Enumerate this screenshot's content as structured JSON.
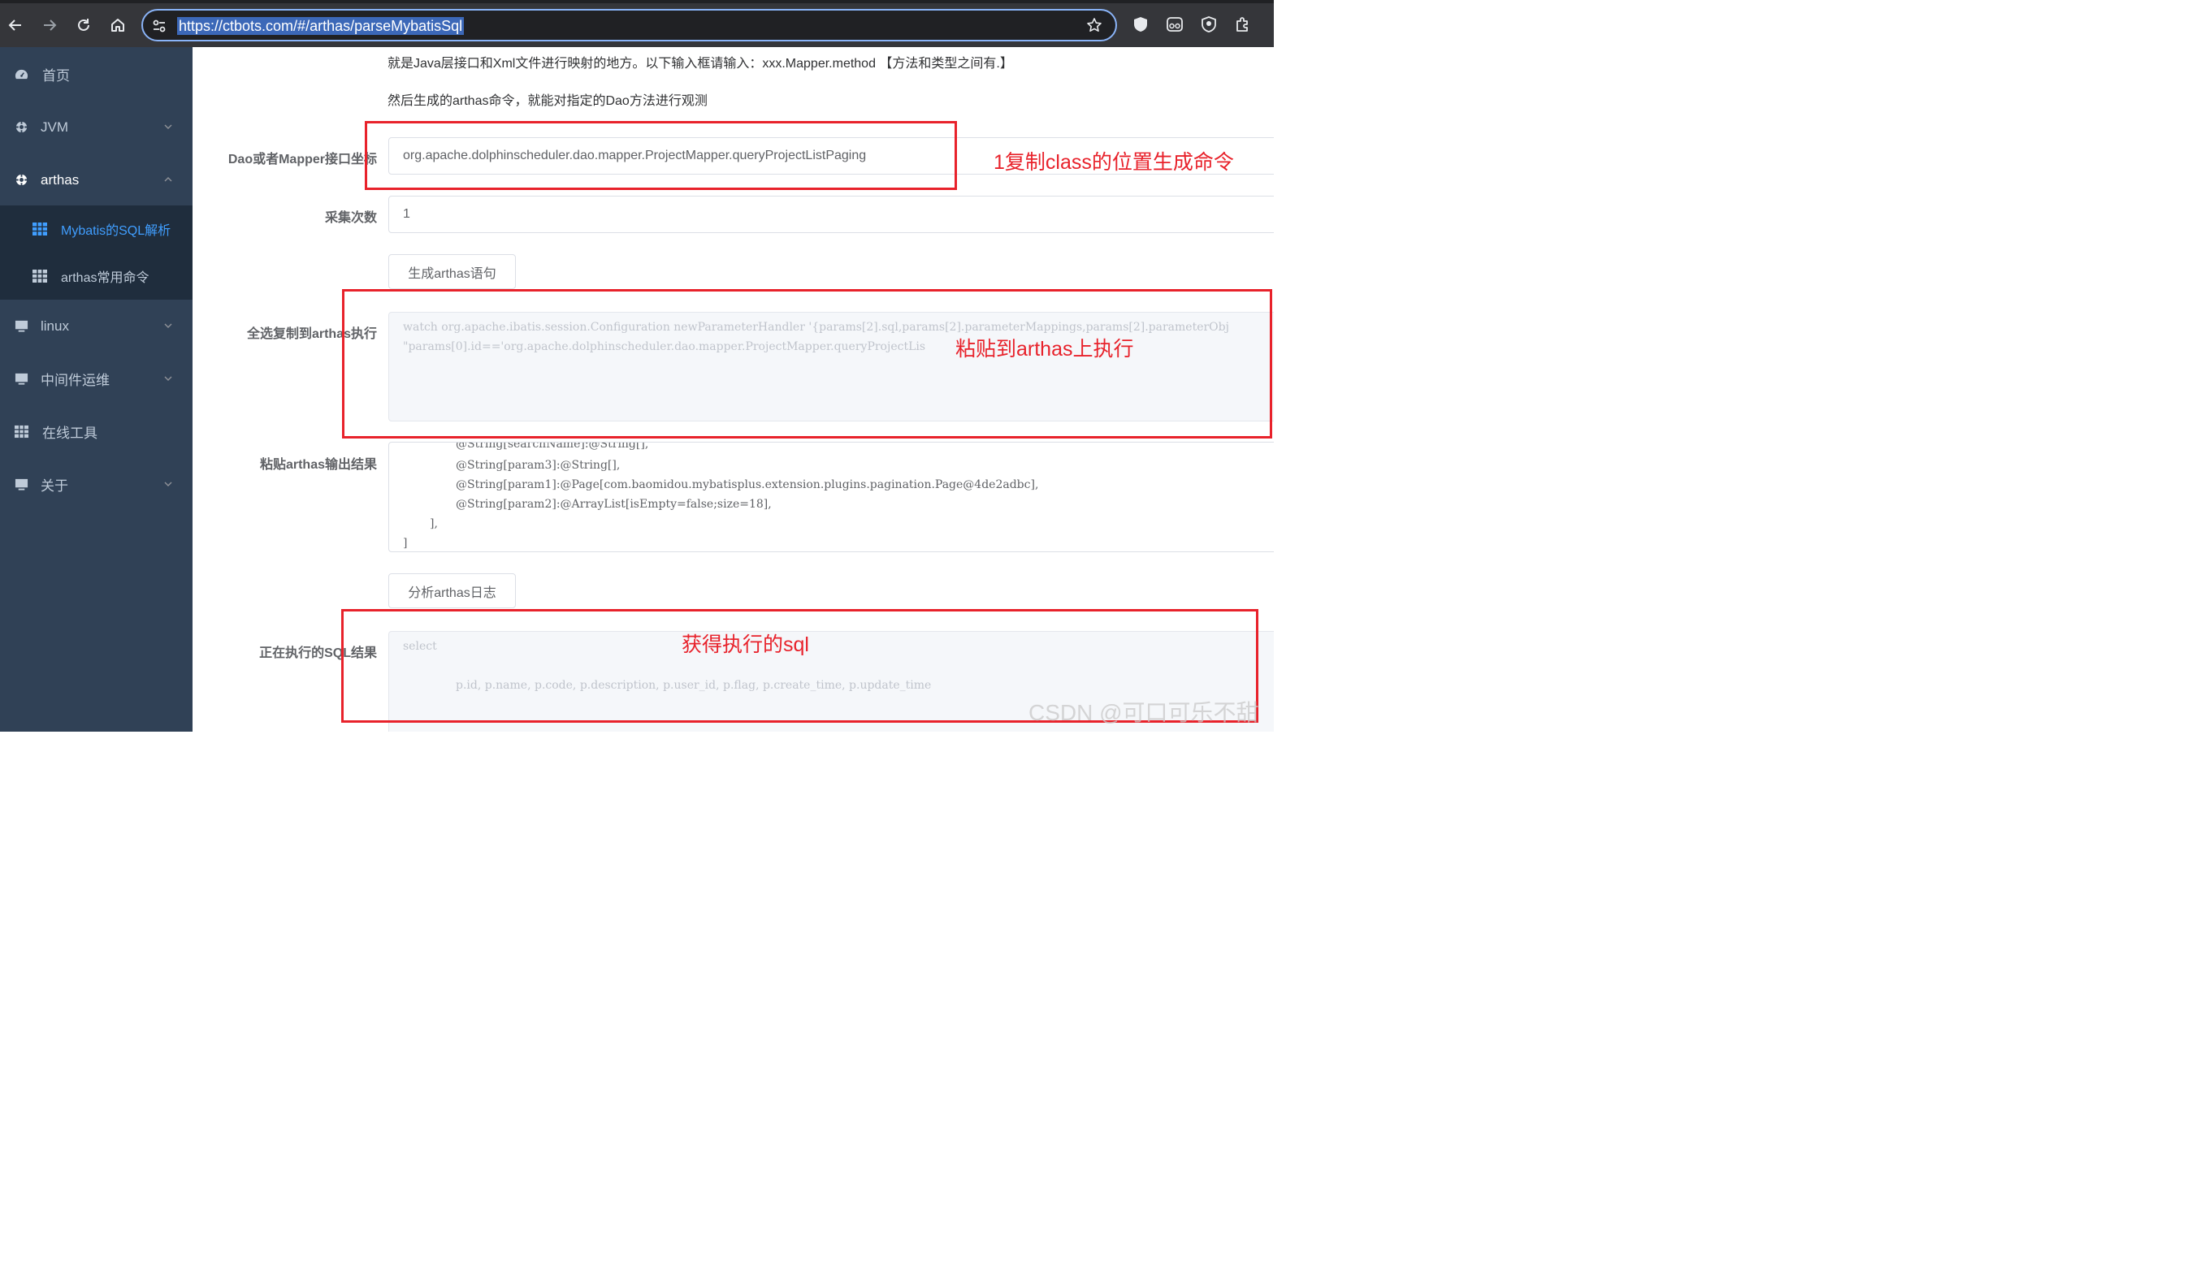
{
  "browser": {
    "url": "https://ctbots.com/#/arthas/parseMybatisSql",
    "icons": [
      "back-icon",
      "forward-icon",
      "reload-icon",
      "home-icon",
      "site-settings-icon",
      "bookmark-star-icon",
      "extension-shield-icon",
      "extension-glasses-icon",
      "extension-badge-icon",
      "extensions-puzzle-icon"
    ]
  },
  "sidebar": {
    "items": [
      {
        "label": "首页",
        "icon": "dashboard-icon"
      },
      {
        "label": "JVM",
        "icon": "cog-icon"
      },
      {
        "label": "arthas",
        "icon": "cog-icon"
      },
      {
        "label": "linux",
        "icon": "monitor-icon"
      },
      {
        "label": "中间件运维",
        "icon": "monitor-icon"
      },
      {
        "label": "在线工具",
        "icon": "grid-icon"
      },
      {
        "label": "关于",
        "icon": "monitor-icon"
      }
    ],
    "submenu": [
      {
        "label": "Mybatis的SQL解析",
        "icon": "grid-icon",
        "active": true
      },
      {
        "label": "arthas常用命令",
        "icon": "grid-icon",
        "active": false
      }
    ]
  },
  "main": {
    "desc_line1": "就是Java层接口和Xml文件进行映射的地方。以下输入框请输入：xxx.Mapper.method 【方法和类型之间有.】",
    "desc_line2": "然后生成的arthas命令，就能对指定的Dao方法进行观测",
    "form": {
      "mapper_label": "Dao或者Mapper接口坐标",
      "mapper_value": "org.apache.dolphinscheduler.dao.mapper.ProjectMapper.queryProjectListPaging",
      "count_label": "采集次数",
      "count_value": "1",
      "generate_button": "生成arthas语句",
      "command_label": "全选复制到arthas执行",
      "command_lines": [
        "watch org.apache.ibatis.session.Configuration newParameterHandler '{params[2].sql,params[2].parameterMappings,params[2].parameterObj",
        "\"params[0].id=='org.apache.dolphinscheduler.dao.mapper.ProjectMapper.queryProjectLis"
      ],
      "output_label": "粘贴arthas输出结果",
      "output_lines": [
        "@String[searchName]:@String[],",
        "@String[param3]:@String[],",
        "@String[param1]:@Page[com.baomidou.mybatisplus.extension.plugins.pagination.Page@4de2adbc],",
        "@String[param2]:@ArrayList[isEmpty=false;size=18],",
        "],",
        "]"
      ],
      "analyze_button": "分析arthas日志",
      "sql_label": "正在执行的SQL结果",
      "sql_lines": [
        "select",
        "p.id,  p.name,  p.code,  p.description,  p.user_id,  p.flag,  p.create_time,  p.update_time"
      ]
    }
  },
  "annotations": {
    "note1": "1复制class的位置生成命令",
    "note2": "粘贴到arthas上执行",
    "note3": "获得执行的sql",
    "color": "#e8222b"
  },
  "watermark": "CSDN @可口可乐不甜"
}
